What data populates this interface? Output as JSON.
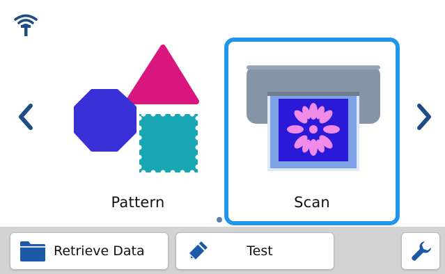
{
  "status_bar": {
    "wifi_icon": "wifi-signal-icon"
  },
  "carousel": {
    "prev_icon": "chevron-left-icon",
    "next_icon": "chevron-right-icon",
    "items": [
      {
        "label": "Pattern",
        "icon": "shapes-pattern-icon",
        "selected": false
      },
      {
        "label": "Scan",
        "icon": "scanner-icon",
        "selected": true
      }
    ],
    "selected_border_color": "#2196e8"
  },
  "toolbar": {
    "retrieve_label": "Retrieve Data",
    "retrieve_icon": "folder-icon",
    "test_label": "Test",
    "test_icon": "pen-icon",
    "settings_icon": "wrench-icon"
  },
  "colors": {
    "accent": "#2196e8",
    "nav_arrow": "#1e4d86",
    "toolbar_bg": "#d3d3d3",
    "folder": "#1c5aa8"
  }
}
